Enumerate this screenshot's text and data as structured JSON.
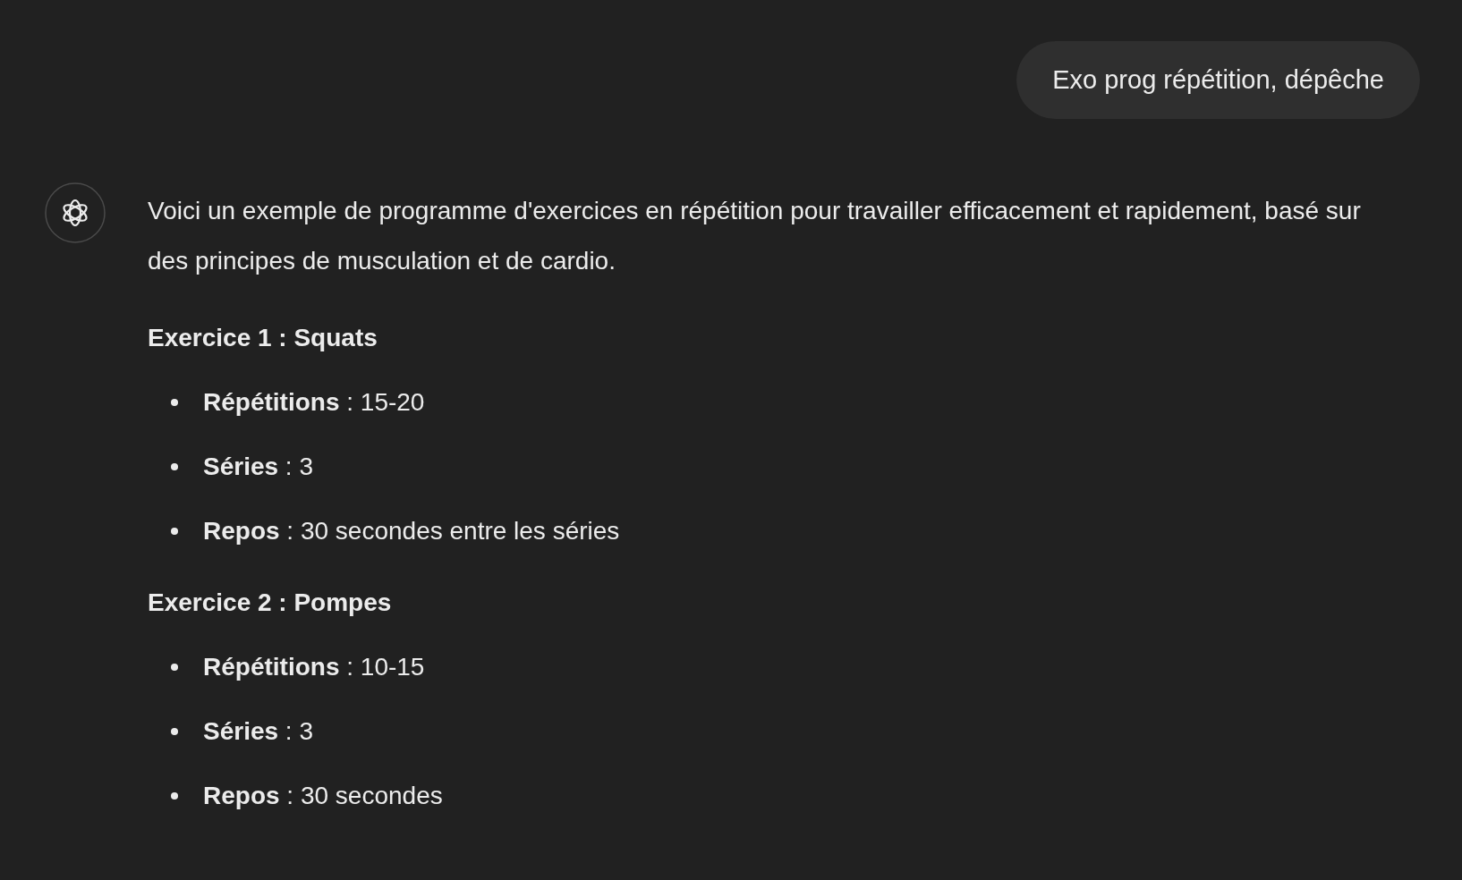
{
  "user_message": "Exo prog répétition, dépêche",
  "assistant": {
    "intro": "Voici un exemple de programme d'exercices en répétition pour travailler efficacement et rapidement, basé sur des principes de musculation et de cardio.",
    "sections": [
      {
        "heading": "Exercice 1 : Squats",
        "items": [
          "**Répétitions** : 15-20",
          "**Séries** : 3",
          "**Repos** : 30 secondes entre les séries"
        ]
      },
      {
        "heading": "Exercice 2 : Pompes",
        "items": [
          "**Répétitions** : 10-15",
          "**Séries** : 3",
          "**Repos** : 30 secondes"
        ]
      }
    ]
  }
}
